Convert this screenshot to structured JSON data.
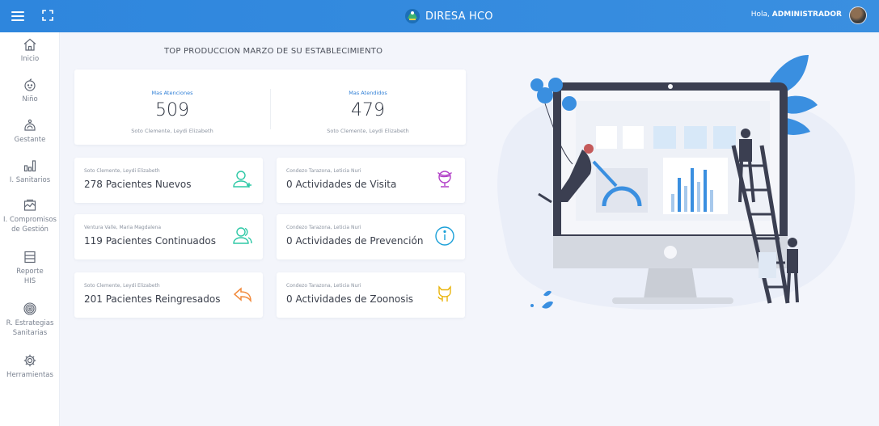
{
  "header": {
    "brand": "DIRESA HCO",
    "greeting_prefix": "Hola,",
    "user": "ADMINISTRADOR"
  },
  "sidebar": {
    "items": [
      {
        "label": "Inicio",
        "icon": "home-icon"
      },
      {
        "label": "Niño",
        "icon": "baby-icon"
      },
      {
        "label": "Gestante",
        "icon": "pregnant-icon"
      },
      {
        "label": "I. Sanitarios",
        "icon": "bar-chart-icon"
      },
      {
        "label": "I. Compromisos",
        "label2": "de Gestión",
        "icon": "report-icon"
      },
      {
        "label": "Reporte",
        "label2": "HIS",
        "icon": "list-icon"
      },
      {
        "label": "R. Estrategias",
        "label2": "Sanitarias",
        "icon": "target-icon"
      },
      {
        "label": "Herramientas",
        "icon": "gear-icon"
      }
    ]
  },
  "main": {
    "title": "TOP PRODUCCION MARZO DE SU ESTABLECIMIENTO",
    "top_stats": [
      {
        "label": "Mas Atenciones",
        "value": "509",
        "name": "Soto Clemente, Leydi Elizabeth"
      },
      {
        "label": "Mas Atendidos",
        "value": "479",
        "name": "Soto Clemente, Leydi Elizabeth"
      }
    ],
    "metrics": [
      {
        "person": "Soto Clemente, Leydi Elizabeth",
        "value": "278 Pacientes Nuevos",
        "icon": "user-plus-icon",
        "color": "#2ec8a6"
      },
      {
        "person": "Condezo Tarazona, Leticia Nuri",
        "value": "0 Actividades de Visita",
        "icon": "globe-icon",
        "color": "#b23fc7"
      },
      {
        "person": "Ventura Valle, Maria Magdalena",
        "value": "119 Pacientes Continuados",
        "icon": "users-icon",
        "color": "#2ec8a6"
      },
      {
        "person": "Condezo Tarazona, Leticia Nuri",
        "value": "0 Actividades de Prevención",
        "icon": "info-icon",
        "color": "#1ba0d8"
      },
      {
        "person": "Soto Clemente, Leydi Elizabeth",
        "value": "201 Pacientes Reingresados",
        "icon": "reply-icon",
        "color": "#f28a3c"
      },
      {
        "person": "Condezo Tarazona, Leticia Nuri",
        "value": "0 Actividades de Zoonosis",
        "icon": "github-icon",
        "color": "#e9b40b"
      }
    ]
  },
  "colors": {
    "topbar": "#2e86dd",
    "accent": "#2f7fd6",
    "background": "#f3f5fb"
  }
}
